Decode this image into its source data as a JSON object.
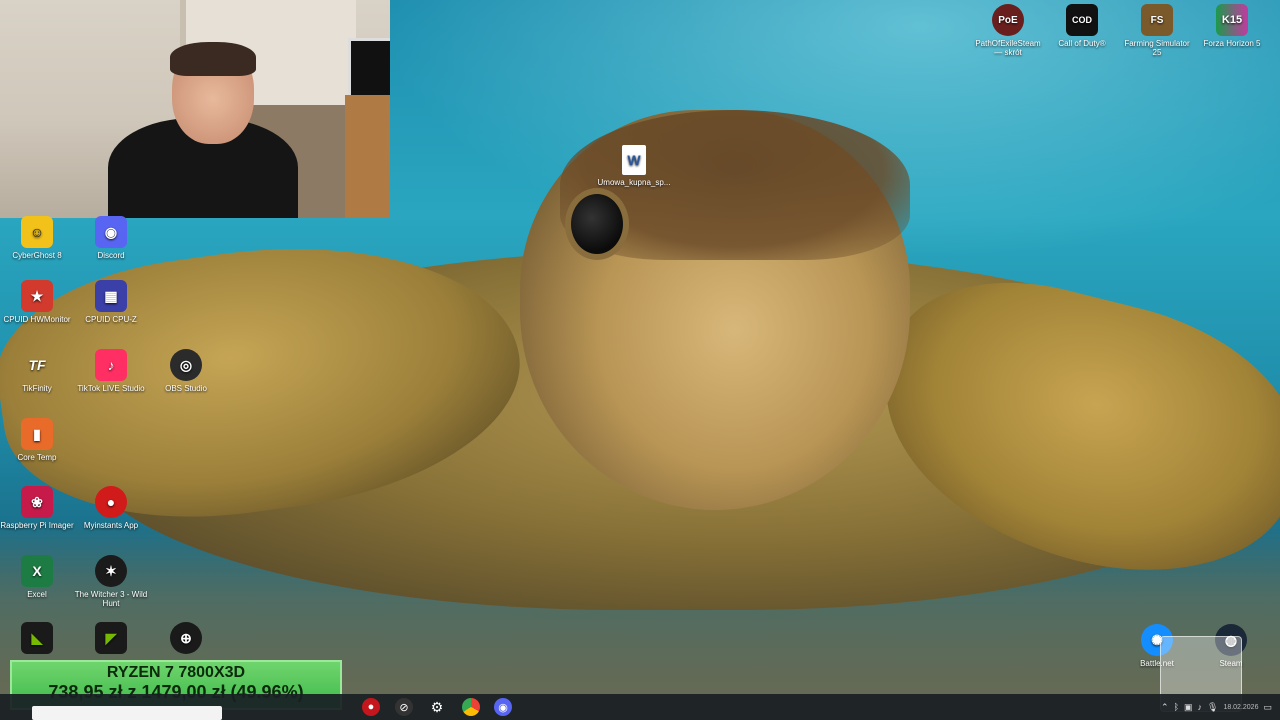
{
  "desktop": {
    "left_icons": [
      {
        "label": "CyberGhost 8",
        "icon": "cyberghost-icon",
        "color": "#f2c21b",
        "glyph": "☺"
      },
      {
        "label": "Discord",
        "icon": "discord-icon",
        "color": "#5865f2",
        "glyph": "◉"
      },
      {
        "label": "CPUID HWMonitor",
        "icon": "hwmonitor-icon",
        "color": "#d23a2e",
        "glyph": "★"
      },
      {
        "label": "CPUID CPU-Z",
        "icon": "cpuz-icon",
        "color": "#3b3fa8",
        "glyph": "▦"
      },
      {
        "label": "TikFinity",
        "icon": "tikfinity-icon",
        "color": "#2a2a2a",
        "glyph": "TF"
      },
      {
        "label": "TikTok LIVE Studio",
        "icon": "tiktok-live-icon",
        "color": "#ff2e63",
        "glyph": "♪"
      },
      {
        "label": "OBS Studio",
        "icon": "obs-icon",
        "color": "#2b2b2b",
        "glyph": "◎"
      },
      {
        "label": "Core Temp",
        "icon": "core-temp-icon",
        "color": "#e86b2a",
        "glyph": "▮"
      },
      {
        "label": "Raspberry Pi Imager",
        "icon": "raspberry-pi-icon",
        "color": "#c51a4a",
        "glyph": "❀"
      },
      {
        "label": "Myinstants App",
        "icon": "myinstants-icon",
        "color": "#d11a1a",
        "glyph": "●"
      },
      {
        "label": "Excel",
        "icon": "excel-icon",
        "color": "#1d7c43",
        "glyph": "X"
      },
      {
        "label": "The Witcher 3 - Wild Hunt",
        "icon": "witcher-icon",
        "color": "#1b1b1b",
        "glyph": "✶"
      }
    ],
    "top_right_icons": [
      {
        "label": "PathOfExileSteam — skrót",
        "icon": "path-of-exile-icon",
        "color": "#6a1f1f",
        "glyph": "PoE"
      },
      {
        "label": "Call of Duty®",
        "icon": "call-of-duty-icon",
        "color": "#111111",
        "glyph": "COD"
      },
      {
        "label": "Farming Simulator 25",
        "icon": "farming-simulator-icon",
        "color": "#7a5a2a",
        "glyph": "FS"
      },
      {
        "label": "Forza Horizon 5",
        "icon": "forza-horizon-icon",
        "color": "#1c9a4c",
        "glyph": "K15"
      }
    ],
    "file_icon": {
      "label": "Umowa_kupna_sp...",
      "icon": "word-document-icon"
    },
    "bottom_right": [
      {
        "label": "Battle.net",
        "icon": "battlenet-icon"
      },
      {
        "label": "Steam",
        "icon": "steam-icon"
      }
    ]
  },
  "overlay": {
    "title": "RYZEN 7 7800X3D",
    "price_line": "738,95 zł z 1479,00 zł (49.96%)",
    "progress": 0.4996
  },
  "taskbar": {
    "icons": [
      "record-icon",
      "compass-icon",
      "settings-gear-icon",
      "chrome-icon",
      "discord-taskbar-icon"
    ],
    "tray": [
      "chevron-up-icon",
      "bluetooth-icon",
      "network-icon",
      "volume-icon",
      "microphone-icon"
    ],
    "date": "18.02.2026"
  },
  "colors": {
    "taskbar": "#191e24",
    "price_bg": "#3fb94b"
  }
}
